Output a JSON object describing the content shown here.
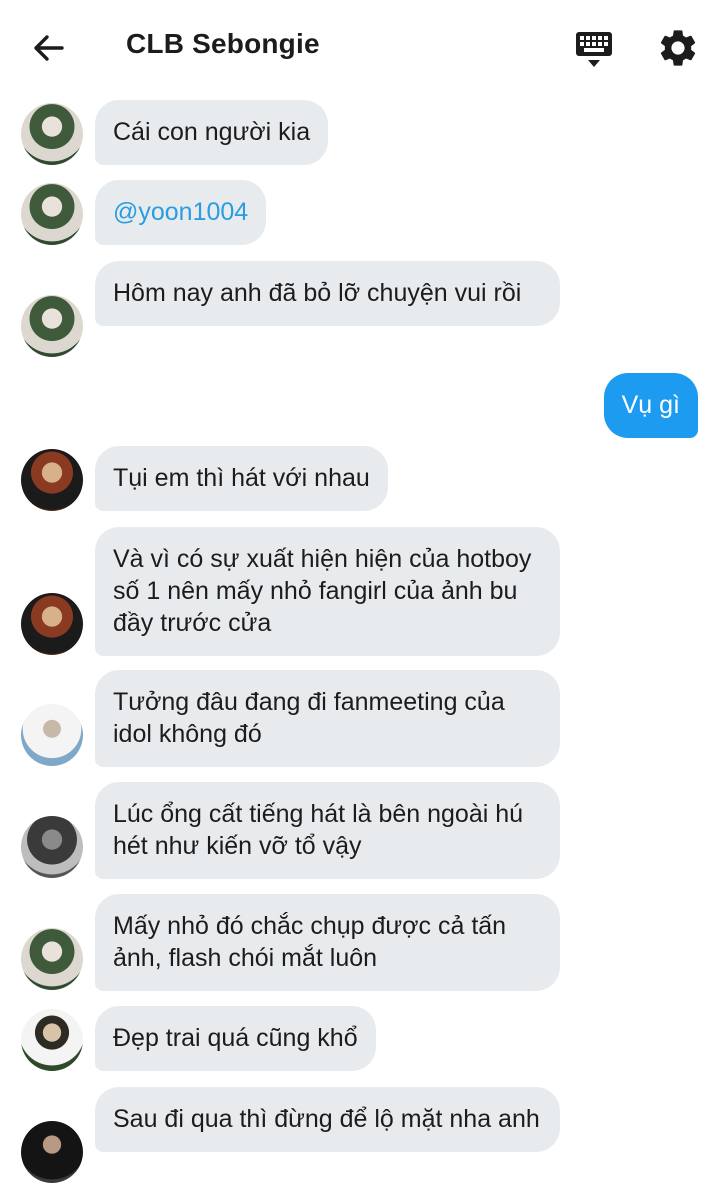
{
  "header": {
    "title": "CLB Sebongie",
    "back_icon": "arrow-left-icon",
    "keyboard_icon": "keyboard-icon",
    "settings_icon": "gear-icon"
  },
  "messages": [
    {
      "text": "Cái con người kia",
      "avatar": "avatar-1"
    },
    {
      "text": "@yoon1004",
      "avatar": "avatar-1"
    },
    {
      "text": "Hôm nay anh đã bỏ lỡ chuyện vui rồi",
      "avatar": "avatar-1"
    },
    {
      "text": "Vụ gì",
      "outgoing": true
    },
    {
      "text": "Tụi em thì hát với nhau",
      "avatar": "avatar-2"
    },
    {
      "text": "Và vì có sự xuất hiện hiện của hotboy số 1 nên mấy nhỏ fangirl của ảnh bu đầy trước cửa",
      "avatar": "avatar-2"
    },
    {
      "text": "Tưởng đâu đang đi fanmeeting của idol không đó",
      "avatar": "avatar-3"
    },
    {
      "text": "Lúc ổng cất tiếng hát là bên ngoài hú hét như kiến vỡ tổ vậy",
      "avatar": "avatar-4"
    },
    {
      "text": "Mấy nhỏ đó chắc chụp được cả tấn ảnh, flash chói mắt luôn",
      "avatar": "avatar-1"
    },
    {
      "text": "Đẹp trai quá cũng khổ",
      "avatar": "avatar-5"
    },
    {
      "text": "Sau đi qua thì đừng để lộ mặt nha anh",
      "avatar": "avatar-6"
    }
  ],
  "colors": {
    "incoming_bubble": "#e8ebee",
    "outgoing_bubble": "#1d9bf0",
    "mention": "#2a9de0"
  }
}
